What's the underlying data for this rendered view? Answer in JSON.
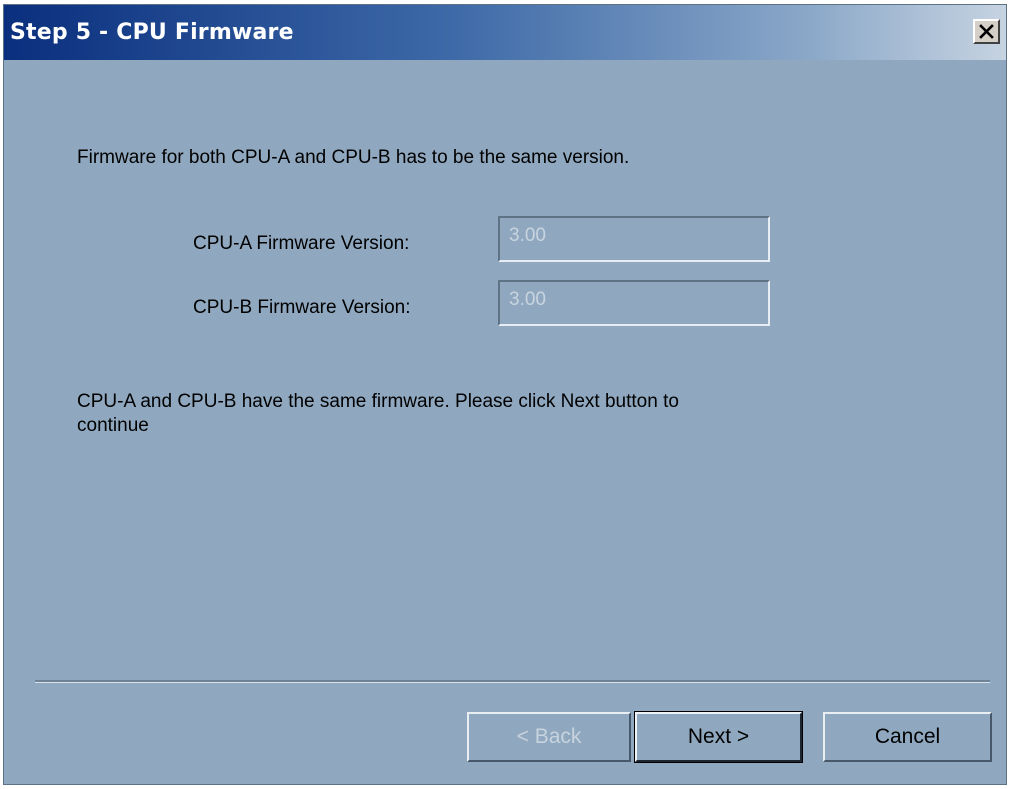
{
  "window": {
    "title": "Step 5 - CPU Firmware",
    "close_symbol": "close-icon"
  },
  "content": {
    "intro_text": "Firmware for both CPU-A and CPU-B has to be the same version.",
    "cpu_a": {
      "label": "CPU-A Firmware Version:",
      "value": "3.00"
    },
    "cpu_b": {
      "label": "CPU-B Firmware Version:",
      "value": "3.00"
    },
    "status_line1": "CPU-A and CPU-B have the same firmware. Please click Next button to",
    "status_line2": "continue"
  },
  "buttons": {
    "back_label": "< Back",
    "next_label": "Next >",
    "cancel_label": "Cancel"
  },
  "colors": {
    "dialog_background": "#8fa8bf",
    "title_gradient_start": "#0a2f7e",
    "title_text": "#ffffff"
  }
}
